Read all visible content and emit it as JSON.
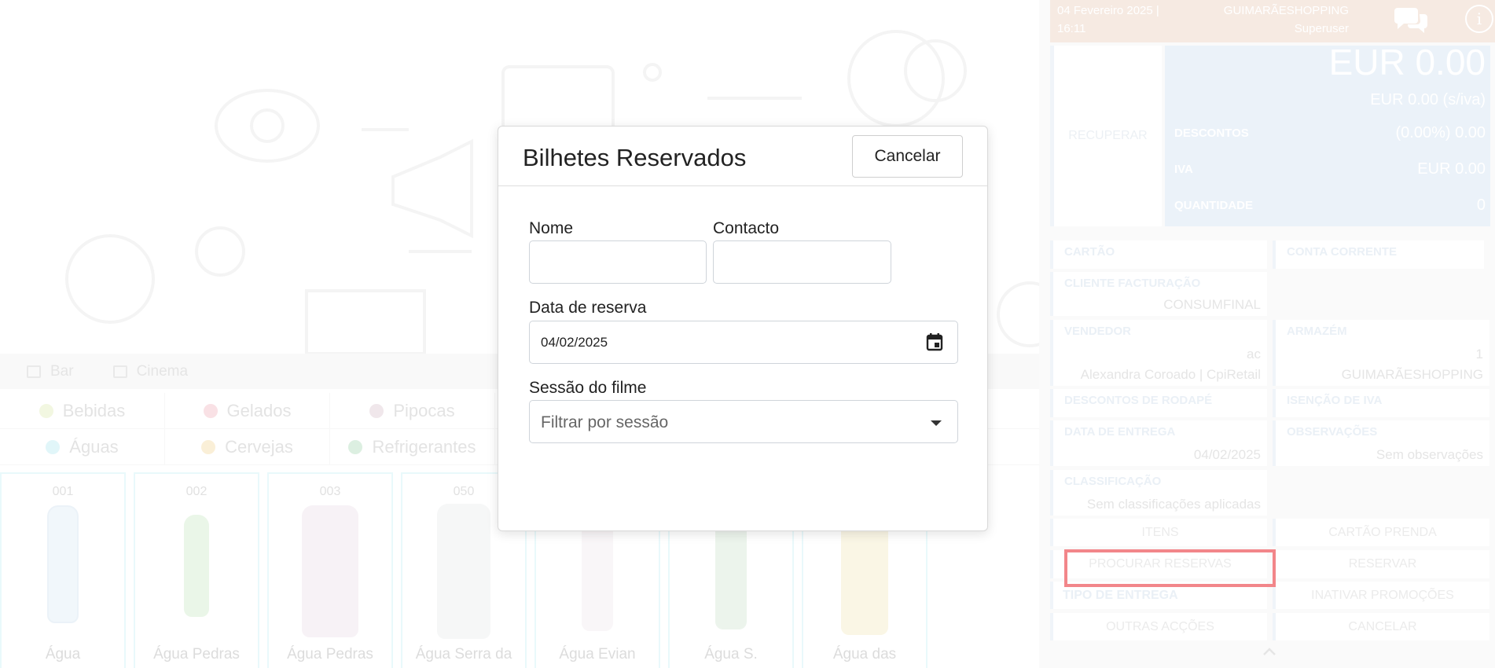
{
  "header": {
    "datetime": "04 Fevereiro 2025 | 16:11",
    "store": "GUIMARÃESHOPPING",
    "user": "Superuser",
    "chat_icon": "chat-bubbles-icon",
    "info_icon": "info-icon"
  },
  "categories": [
    {
      "label": "Bar",
      "icon": "beer-mug-icon"
    },
    {
      "label": "Cinema",
      "icon": "film-icon"
    }
  ],
  "subcategories_row1": [
    {
      "label": "Bebidas",
      "color": "#e8f0c8"
    },
    {
      "label": "Gelados",
      "color": "#f5c8cf"
    },
    {
      "label": "Pipocas",
      "color": "#e4d4da"
    }
  ],
  "subcategories_row2": [
    {
      "label": "Águas",
      "color": "#c9eef4"
    },
    {
      "label": "Cervejas",
      "color": "#f6e2b6"
    },
    {
      "label": "Refrigerantes",
      "color": "#bfe2c8"
    }
  ],
  "products": [
    {
      "code": "001",
      "name": "Água"
    },
    {
      "code": "002",
      "name": "Água Pedras"
    },
    {
      "code": "003",
      "name": "Água Pedras"
    },
    {
      "code": "050",
      "name": "Água Serra da"
    },
    {
      "code": "",
      "name": "Água Evian"
    },
    {
      "code": "",
      "name": "Água S."
    },
    {
      "code": "",
      "name": "Água das"
    }
  ],
  "totals": {
    "recuperar": "RECUPERAR",
    "total": "EUR 0.00",
    "total_no_vat": "EUR 0.00 (s/iva)",
    "discounts_label": "DESCONTOS",
    "discounts_value": "(0.00%) 0.00",
    "vat_label": "IVA",
    "vat_value": "EUR 0.00",
    "qty_label": "QUANTIDADE",
    "qty_value": "0"
  },
  "info": {
    "cartao": "CARTÃO",
    "conta_corrente": "CONTA CORRENTE",
    "cliente_label": "CLIENTE FACTURAÇÃO",
    "cliente_value": "CONSUMFINAL",
    "vendedor_label": "VENDEDOR",
    "vendedor_code": "ac",
    "vendedor_value": "Alexandra Coroado | CpiRetail",
    "armazem_label": "ARMAZÉM",
    "armazem_code": "1",
    "armazem_value": "GUIMARÃESHOPPING",
    "descontos_rodape": "DESCONTOS DE RODAPÉ",
    "isencao_iva": "ISENÇÃO DE IVA",
    "entrega_label": "DATA DE ENTREGA",
    "entrega_value": "04/02/2025",
    "obs_label": "OBSERVAÇÕES",
    "obs_value": "Sem observações",
    "class_label": "CLASSIFICAÇÃO",
    "class_value": "Sem classificações aplicadas"
  },
  "actions": {
    "itens": "ITENS",
    "cartao_prenda": "CARTÃO PRENDA",
    "procurar_reservas": "PROCURAR RESERVAS",
    "reservar": "RESERVAR",
    "tipo_entrega": "TIPO DE ENTREGA",
    "inativar_promocoes": "INATIVAR PROMOÇÕES",
    "outras_accoes": "OUTRAS ACÇÕES",
    "cancelar": "CANCELAR"
  },
  "modal": {
    "title": "Bilhetes Reservados",
    "cancel_label": "Cancelar",
    "name_label": "Nome",
    "name_value": "",
    "contact_label": "Contacto",
    "contact_value": "",
    "date_label": "Data de reserva",
    "date_value": "04/02/2025",
    "session_label": "Sessão do filme",
    "session_placeholder": "Filtrar por sessão"
  }
}
